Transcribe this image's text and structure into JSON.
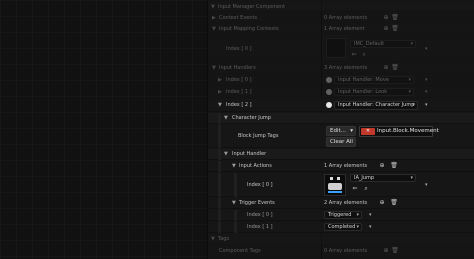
{
  "panel": {
    "title": "Input Manager Component",
    "rows": {
      "context_events": {
        "label": "Context Events",
        "value": "0 Array elements"
      },
      "mapping_contexts": {
        "label": "Input Mapping Contexts",
        "value": "1 Array element"
      },
      "mapping_index0": {
        "label": "Index [ 0 ]",
        "asset": "IMC_Default"
      },
      "input_handlers": {
        "label": "Input Handlers",
        "value": "3 Array elements"
      },
      "handler0": {
        "label": "Index [ 0 ]",
        "value": "Input Handler: Move"
      },
      "handler1": {
        "label": "Index [ 1 ]",
        "value": "Input Handler: Look"
      },
      "handler2": {
        "label": "Index [ 2 ]",
        "value": "Input Handler: Character Jump"
      },
      "character_jump": {
        "label": "Character Jump"
      },
      "block_jump_tags": {
        "label": "Block Jump Tags",
        "edit_label": "Edit...",
        "clear_label": "Clear All",
        "tag": "Input.Block.Movement"
      },
      "input_handler": {
        "label": "Input Handler"
      },
      "input_actions": {
        "label": "Input Actions",
        "value": "1 Array elements"
      },
      "action0": {
        "label": "Index [ 0 ]",
        "asset": "IA_Jump"
      },
      "trigger_events": {
        "label": "Trigger Events",
        "value": "2 Array elements"
      },
      "trigger0": {
        "label": "Index [ 0 ]",
        "value": "Triggered"
      },
      "trigger1": {
        "label": "Index [ 1 ]",
        "value": "Completed"
      },
      "tags": {
        "label": "Tags"
      },
      "component_tags": {
        "label": "Component Tags",
        "value": "0 Array elements"
      }
    }
  }
}
